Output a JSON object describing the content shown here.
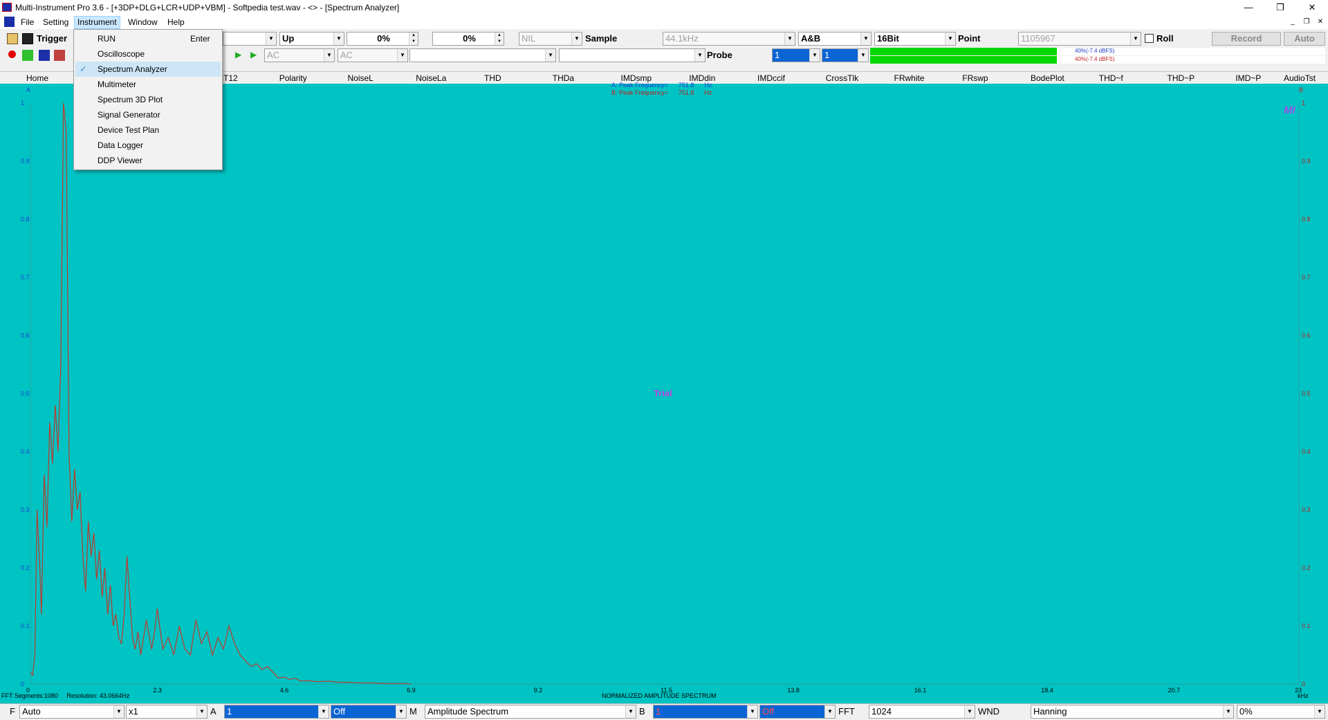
{
  "window": {
    "title": "Multi-Instrument Pro 3.6  -  [+3DP+DLG+LCR+UDP+VBM]  -  Softpedia test.wav  -  <> - [Spectrum Analyzer]",
    "controls": {
      "minimize": "—",
      "restore": "❐",
      "close": "✕"
    },
    "mdi_controls": {
      "minimize": "_",
      "restore": "❐",
      "close": "✕"
    }
  },
  "menubar": {
    "items": [
      "File",
      "Setting",
      "Instrument",
      "Window",
      "Help"
    ],
    "active": "Instrument"
  },
  "instrument_menu": {
    "items": [
      {
        "label": "RUN",
        "shortcut": "Enter",
        "checked": false
      },
      {
        "label": "Oscilloscope",
        "shortcut": "",
        "checked": false
      },
      {
        "label": "Spectrum Analyzer",
        "shortcut": "",
        "checked": true
      },
      {
        "label": "Multimeter",
        "shortcut": "",
        "checked": false
      },
      {
        "label": "Spectrum 3D Plot",
        "shortcut": "",
        "checked": false
      },
      {
        "label": "Signal Generator",
        "shortcut": "",
        "checked": false
      },
      {
        "label": "Device Test Plan",
        "shortcut": "",
        "checked": false
      },
      {
        "label": "Data Logger",
        "shortcut": "",
        "checked": false
      },
      {
        "label": "DDP Viewer",
        "shortcut": "",
        "checked": false
      }
    ],
    "check_mark": "✓"
  },
  "toolbar1": {
    "trigger_label": "Trigger",
    "trigger_direction": "Up",
    "trigger_level": "0%",
    "trigger_delay": "0%",
    "nil_value": "NIL",
    "sample_label": "Sample",
    "sample_rate": "44.1kHz",
    "channels": "A&B",
    "bits": "16Bit",
    "point_label": "Point",
    "point_value": "1105967",
    "roll_label": "Roll",
    "record_label": "Record",
    "auto_label": "Auto"
  },
  "toolbar2": {
    "coupling_a": "AC",
    "coupling_b": "AC",
    "probe_label": "Probe",
    "probe_a": "1",
    "probe_b": "1",
    "level_a_text": "40%(-7.4 dBFS)",
    "level_b_text": "40%(-7.4 dBFS)",
    "level_a_fraction": 0.4,
    "level_b_fraction": 0.4
  },
  "tabs": [
    "Home",
    "OCT12",
    "Polarity",
    "NoiseL",
    "NoiseLa",
    "THD",
    "THDa",
    "IMDsmp",
    "IMDdin",
    "IMDccif",
    "CrossTlk",
    "FRwhite",
    "FRswp",
    "BodePlot",
    "THD~f",
    "THD~P",
    "IMD~P",
    "AudioTst"
  ],
  "chart_data": {
    "type": "line",
    "xlabel": "NORMALIZED AMPLITUDE SPECTRUM",
    "x_unit": "kHz",
    "x_ticks": [
      "0",
      "2.3",
      "4.6",
      "6.9",
      "9.2",
      "11.5",
      "13.8",
      "16.1",
      "18.4",
      "20.7",
      "23"
    ],
    "y_ticks": [
      "0",
      "0.1",
      "0.2",
      "0.3",
      "0.4",
      "0.5",
      "0.6",
      "0.7",
      "0.8",
      "0.9",
      "1"
    ],
    "xlim": [
      0,
      23
    ],
    "ylim": [
      0,
      1
    ],
    "left_axis_label": "A",
    "right_axis_label": "B",
    "watermark": "Trial",
    "corner_logo": "MI",
    "peak_a": "A: Peak Frequency=      751.8      Hz",
    "peak_b": "B: Peak Frequency=      751.8      Hz",
    "status_left": "FFT Segments:1080     Resolution: 43.0664Hz",
    "colors": {
      "background": "#00c3c3",
      "series": "#c0392b",
      "grid": "#2aa0a0"
    },
    "series": [
      {
        "x": [
          0.0,
          0.04,
          0.08,
          0.12,
          0.17,
          0.2,
          0.25,
          0.3,
          0.35,
          0.4,
          0.45,
          0.5,
          0.55,
          0.6,
          0.65,
          0.7,
          0.75,
          0.8,
          0.85,
          0.9,
          0.95,
          1.0,
          1.05,
          1.1,
          1.15,
          1.2,
          1.25,
          1.3,
          1.35,
          1.4,
          1.45,
          1.5,
          1.55,
          1.6,
          1.65,
          1.7,
          1.75,
          1.8,
          1.85,
          1.9,
          1.95,
          2.0,
          2.1,
          2.2,
          2.25,
          2.3,
          2.4,
          2.5,
          2.6,
          2.7,
          2.8,
          2.9,
          3.0,
          3.1,
          3.2,
          3.3,
          3.4,
          3.5,
          3.6,
          3.7,
          3.8,
          3.9,
          4.0,
          4.1,
          4.2,
          4.3,
          4.4,
          4.5,
          4.6,
          4.7,
          4.8,
          4.9,
          5.0,
          5.2,
          5.4,
          5.6,
          5.8,
          6.0,
          6.2,
          6.4,
          6.6,
          6.8,
          6.9
        ],
        "y": [
          0.02,
          0.015,
          0.05,
          0.3,
          0.2,
          0.12,
          0.36,
          0.27,
          0.45,
          0.38,
          0.48,
          0.4,
          0.55,
          1.0,
          0.95,
          0.4,
          0.28,
          0.37,
          0.3,
          0.33,
          0.22,
          0.16,
          0.28,
          0.22,
          0.26,
          0.18,
          0.23,
          0.15,
          0.2,
          0.12,
          0.17,
          0.1,
          0.12,
          0.08,
          0.07,
          0.12,
          0.22,
          0.15,
          0.08,
          0.06,
          0.09,
          0.05,
          0.11,
          0.06,
          0.09,
          0.13,
          0.06,
          0.08,
          0.05,
          0.1,
          0.06,
          0.05,
          0.11,
          0.07,
          0.09,
          0.05,
          0.08,
          0.06,
          0.1,
          0.07,
          0.05,
          0.04,
          0.03,
          0.035,
          0.025,
          0.03,
          0.02,
          0.01,
          0.012,
          0.008,
          0.01,
          0.005,
          0.006,
          0.004,
          0.005,
          0.003,
          0.003,
          0.002,
          0.002,
          0.001,
          0.001,
          0.001,
          0.0
        ]
      }
    ]
  },
  "bottombar": {
    "f_label": "F",
    "f_value": "Auto",
    "zoom": "x1",
    "a_label": "A",
    "a_value": "1",
    "a_state": "Off",
    "m_label": "M",
    "mode": "Amplitude Spectrum",
    "b_label": "B",
    "b_value": "1",
    "b_state": "Off",
    "fft_label": "FFT",
    "fft_size": "1024",
    "wnd_label": "WND",
    "window_fn": "Hanning",
    "overlap": "0%"
  }
}
